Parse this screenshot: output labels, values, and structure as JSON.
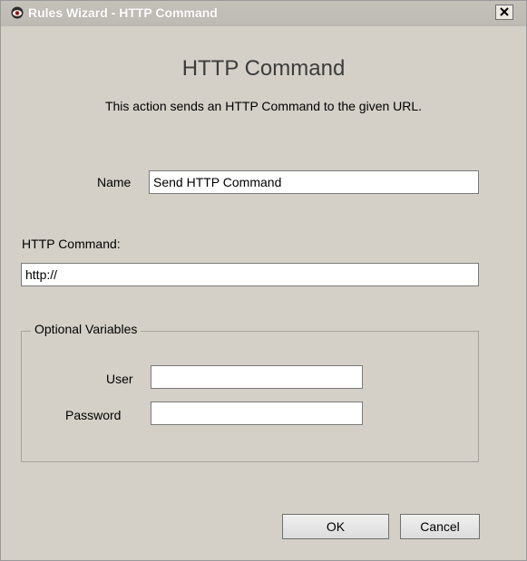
{
  "window": {
    "title": "Rules Wizard - HTTP Command"
  },
  "header": {
    "title": "HTTP Command",
    "description": "This action sends an HTTP Command to the given URL."
  },
  "form": {
    "name_label": "Name",
    "name_value": "Send HTTP Command",
    "http_command_label": "HTTP Command:",
    "http_command_value": "http://",
    "optional_group_label": "Optional Variables",
    "user_label": "User",
    "user_value": "",
    "password_label": "Password",
    "password_value": ""
  },
  "buttons": {
    "ok": "OK",
    "cancel": "Cancel"
  },
  "icons": {
    "app": "eye-icon",
    "close": "close-icon"
  },
  "colors": {
    "dialog_bg": "#d4d0c8",
    "title_text": "#ffffff",
    "app_icon": "#c4302b"
  }
}
